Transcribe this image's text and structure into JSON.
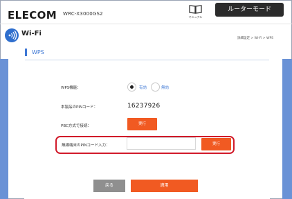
{
  "header": {
    "brand": "ELECOM",
    "model": "WRC-X3000GS2",
    "manual_label": "マニュアル",
    "manual_icon": "book-icon",
    "mode_button": "ルーターモード"
  },
  "page": {
    "section_icon": "wifi-icon",
    "title": "Wi-Fi",
    "breadcrumb": "詳細設定 > Wi-Fi > WPS"
  },
  "wps": {
    "section_title": "WPS",
    "function_label": "WPS機能：",
    "options": [
      {
        "label": "有効",
        "selected": true
      },
      {
        "label": "無効",
        "selected": false
      }
    ],
    "pin_label": "本製品のPINコード：",
    "pin_value": "16237926",
    "pbc_label": "PBC方式で接続：",
    "pbc_button": "実行",
    "client_pin_label": "無線端末のPINコード入力：",
    "client_pin_value": "",
    "client_pin_button": "実行"
  },
  "footer": {
    "back_button": "戻る",
    "apply_button": "適用"
  },
  "colors": {
    "accent": "#f15a22",
    "brand_blue": "#2f6fce",
    "side_blue": "#6a92d6",
    "highlight": "#d11a2a"
  }
}
